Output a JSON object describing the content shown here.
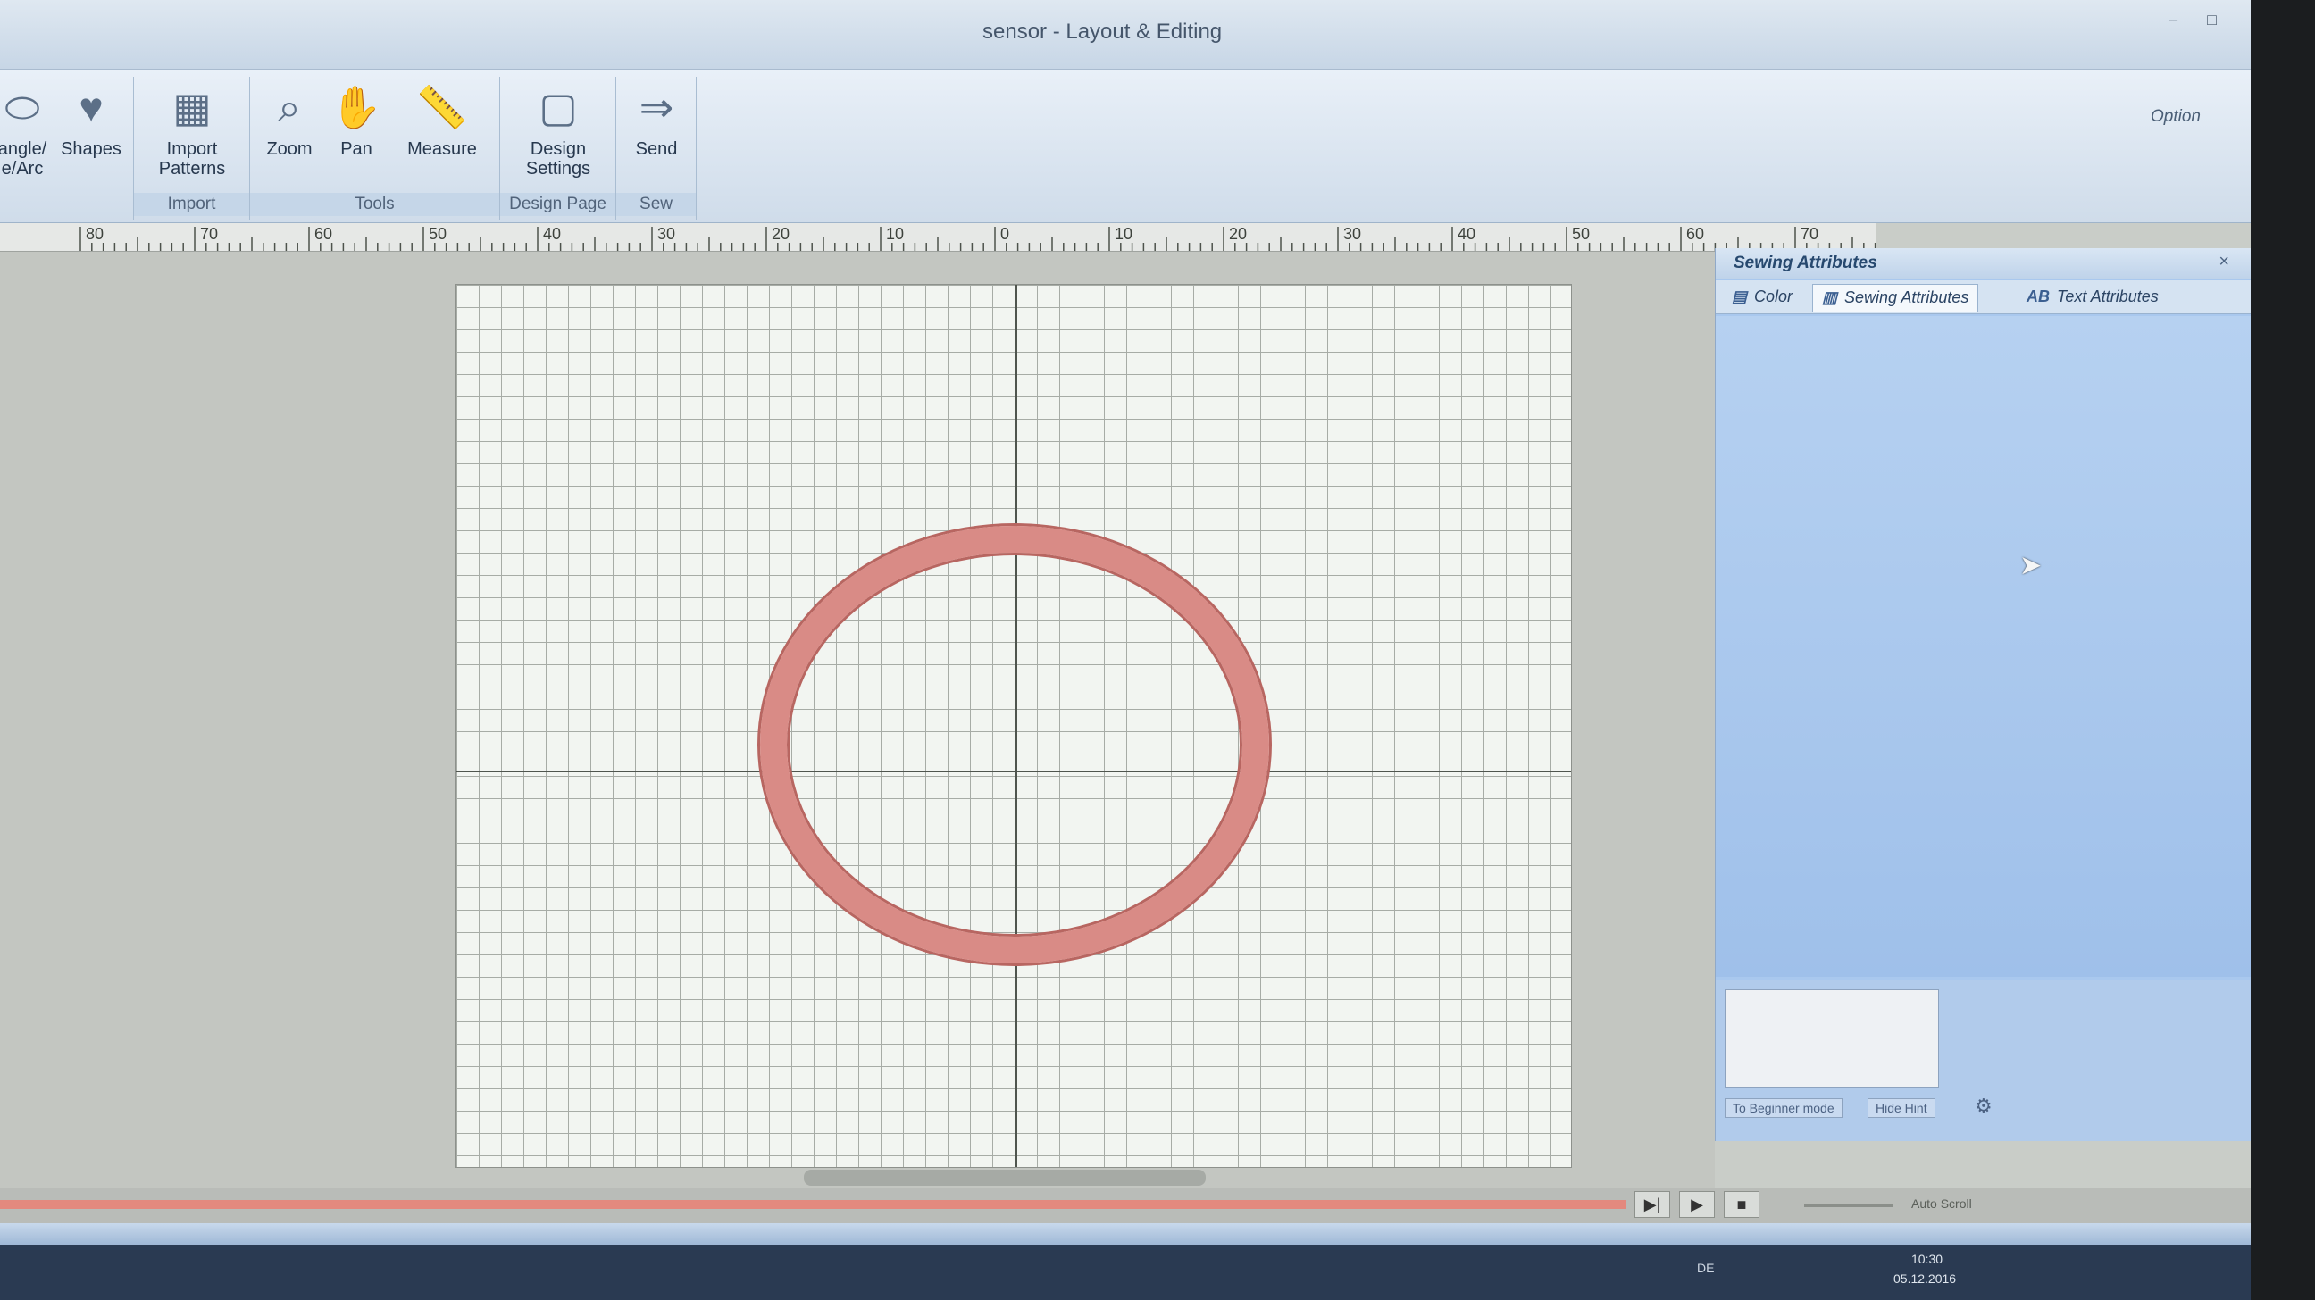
{
  "window": {
    "title": "sensor - Layout & Editing",
    "controls": "– □"
  },
  "ribbon": {
    "option_label": "Option",
    "groups": [
      {
        "label": "",
        "tools": [
          {
            "name": "rectangle-arc-tool",
            "label": "angle/ e/Arc",
            "icon": "ellipse-icon"
          },
          {
            "name": "shapes-tool",
            "label": "Shapes",
            "icon": "heart-star-icon"
          }
        ]
      },
      {
        "label": "Import",
        "tools": [
          {
            "name": "import-patterns",
            "label": "Import Patterns",
            "icon": "import-patterns-icon"
          }
        ]
      },
      {
        "label": "Tools",
        "tools": [
          {
            "name": "zoom",
            "label": "Zoom",
            "icon": "magnifier-icon"
          },
          {
            "name": "pan",
            "label": "Pan",
            "icon": "hand-icon"
          },
          {
            "name": "measure",
            "label": "Measure",
            "icon": "ruler-icon"
          }
        ]
      },
      {
        "label": "Design Page",
        "tools": [
          {
            "name": "design-settings",
            "label": "Design Settings",
            "icon": "design-page-icon"
          }
        ]
      },
      {
        "label": "Sew",
        "tools": [
          {
            "name": "send",
            "label": "Send",
            "icon": "send-icon"
          }
        ]
      }
    ]
  },
  "ruler": {
    "labels": [
      "80",
      "70",
      "60",
      "50",
      "40",
      "30",
      "20",
      "10",
      "0",
      "10",
      "20",
      "30",
      "40",
      "50",
      "60",
      "70"
    ]
  },
  "panel": {
    "title": "Sewing Attributes",
    "close_label": "×",
    "tabs": [
      {
        "label": "Color",
        "icon": "color-icon",
        "active": false
      },
      {
        "label": "Sewing Attributes",
        "icon": "sewing-attributes-icon",
        "active": true
      },
      {
        "label": "Text Attributes",
        "icon": "text-ab-icon",
        "active": false
      }
    ],
    "hint_buttons": [
      "To Beginner mode",
      "Hide Hint"
    ]
  },
  "playback": {
    "auto_scroll_label": "Auto Scroll"
  },
  "taskbar": {
    "language": "DE",
    "time": "10:30",
    "date": "05.12.2016"
  },
  "design": {
    "stitch_color": "#d98b86",
    "accent": "#3b5f91"
  }
}
